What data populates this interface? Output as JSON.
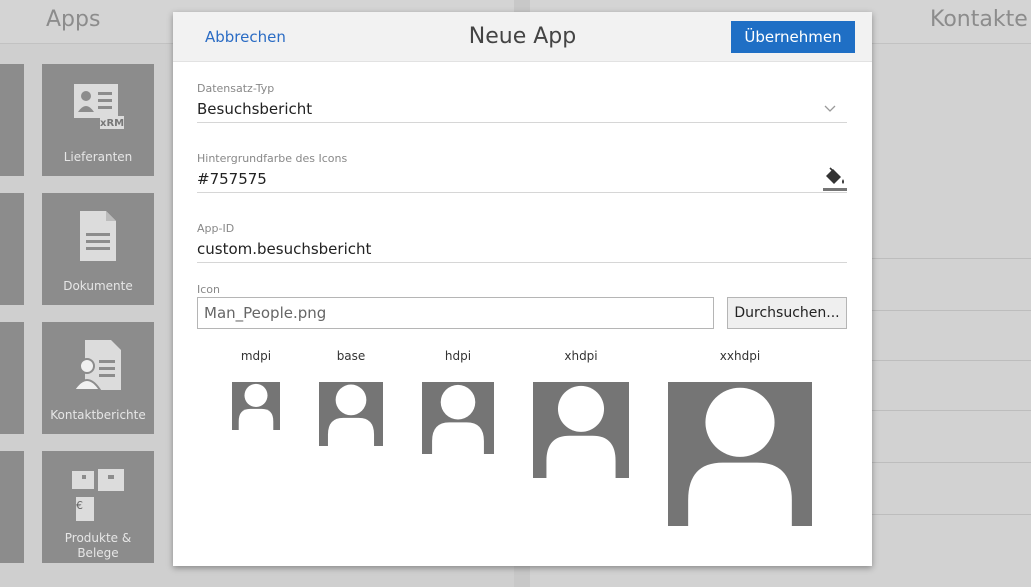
{
  "background": {
    "apps_title": "Apps",
    "kontakte_title": "Kontakte",
    "tiles": [
      {
        "label": "Lieferanten",
        "badge": "xRM",
        "icon": "id-card-icon"
      },
      {
        "label": "Dokumente",
        "icon": "document-icon"
      },
      {
        "label": "Kontaktberichte",
        "icon": "contact-report-icon"
      },
      {
        "label_line1": "Produkte &",
        "label_line2": "Belege",
        "icon": "products-icon",
        "currency": "€"
      }
    ]
  },
  "modal": {
    "cancel_label": "Abbrechen",
    "title": "Neue App",
    "apply_label": "Übernehmen",
    "fields": {
      "record_type": {
        "label": "Datensatz-Typ",
        "value": "Besuchsbericht"
      },
      "bg_color": {
        "label": "Hintergrundfarbe des Icons",
        "value": "#757575"
      },
      "app_id": {
        "label": "App-ID",
        "value": "custom.besuchsbericht"
      },
      "icon": {
        "label": "Icon",
        "value": "Man_People.png",
        "browse_label": "Durchsuchen..."
      }
    },
    "previews": [
      {
        "label": "mdpi"
      },
      {
        "label": "base"
      },
      {
        "label": "hdpi"
      },
      {
        "label": "xhdpi"
      },
      {
        "label": "xxhdpi"
      }
    ]
  },
  "colors": {
    "accent": "#1f6fc5",
    "link": "#2b6cc4",
    "icon_bg": "#757575"
  }
}
